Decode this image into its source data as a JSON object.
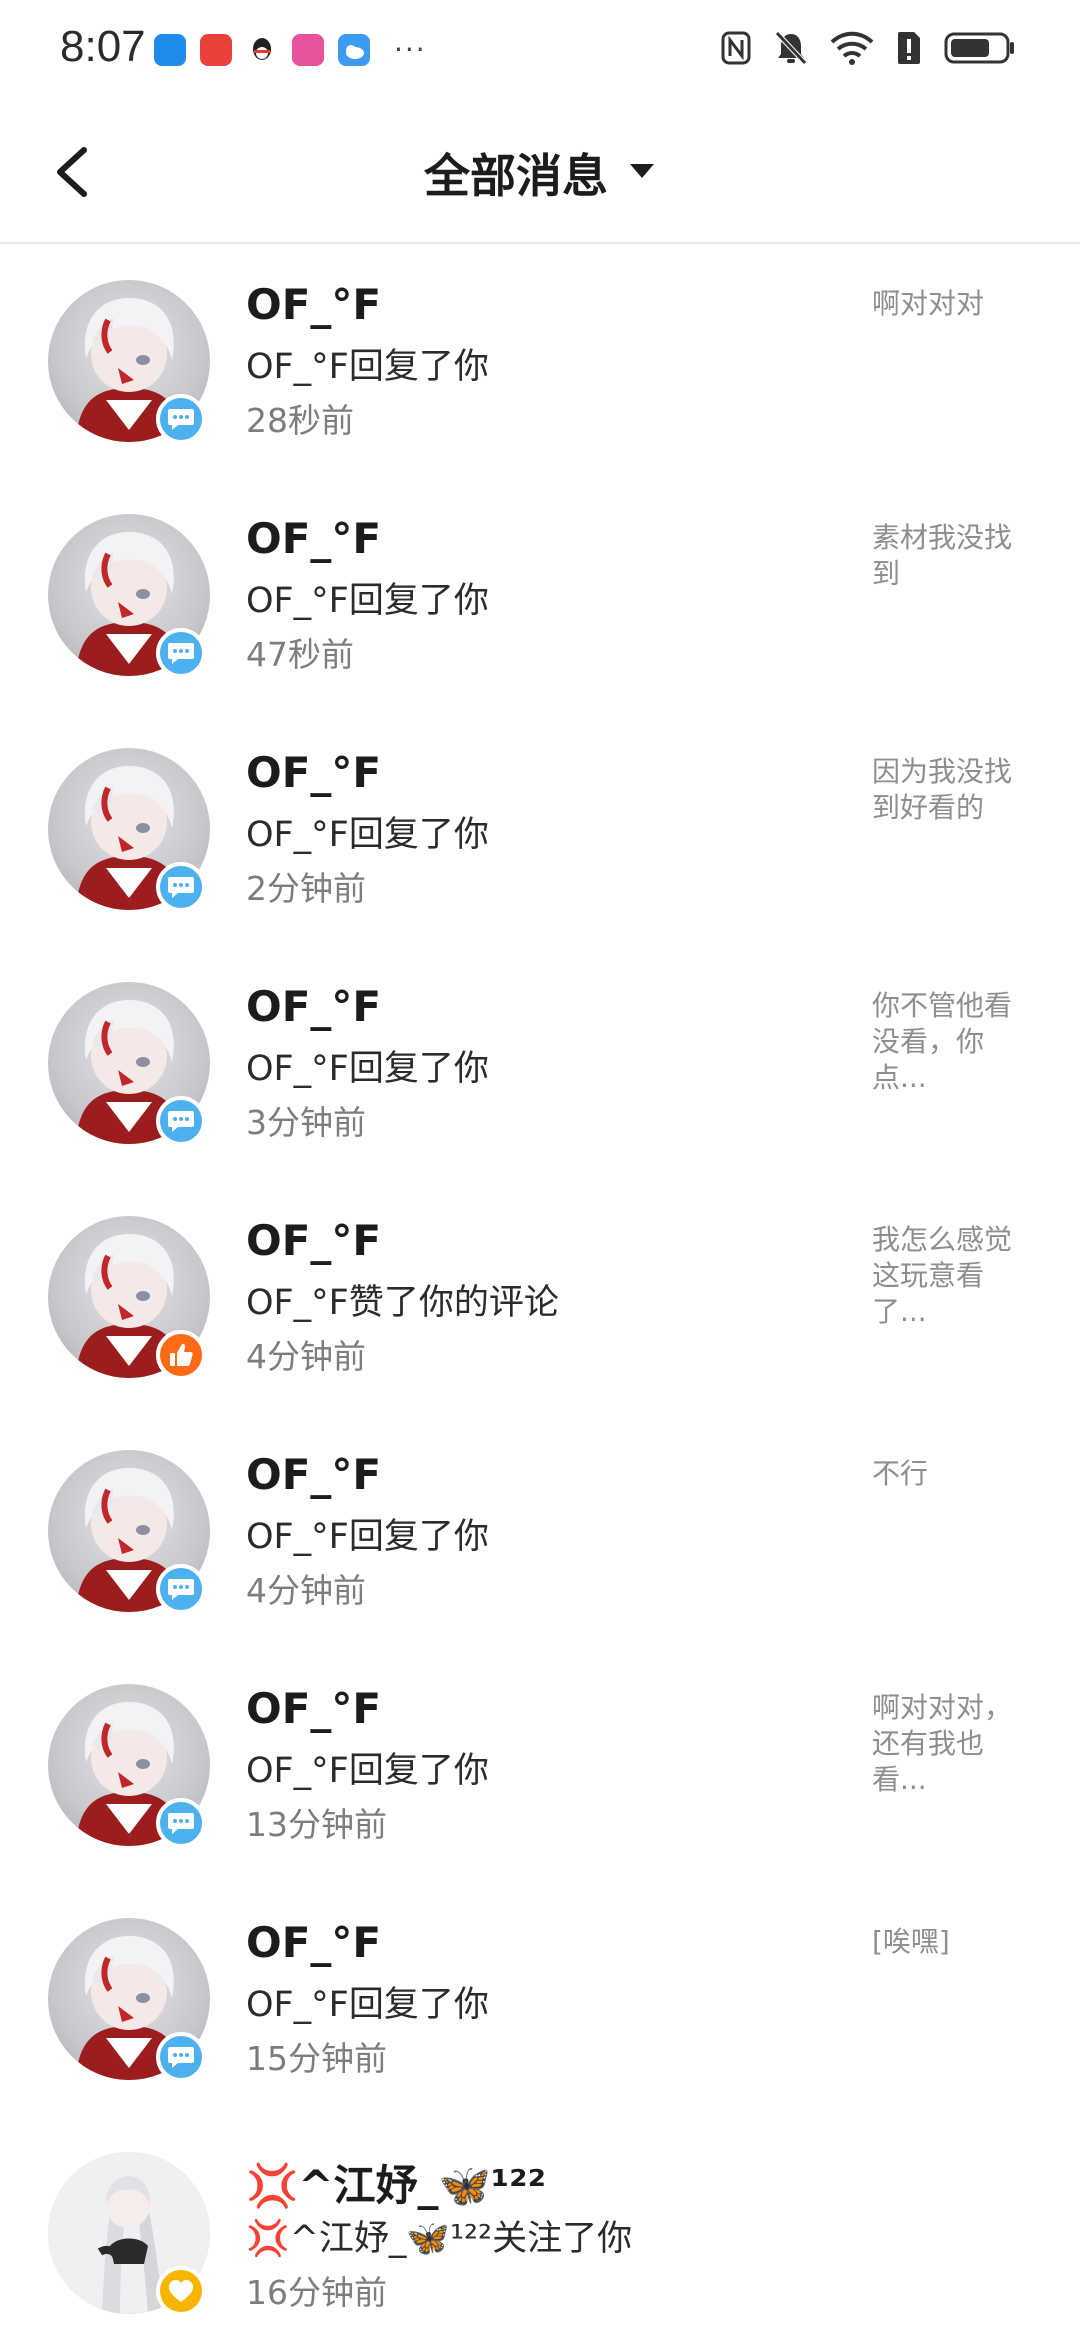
{
  "status_bar": {
    "time": "8:07",
    "app_icons": [
      {
        "icon": "app-blue-icon",
        "color": "#1e8ce8"
      },
      {
        "icon": "huawei-app-icon",
        "color": "#e8413c"
      },
      {
        "icon": "qq-penguin-icon",
        "color": "#222222"
      },
      {
        "icon": "pink-app-icon",
        "color": "#e8529a"
      },
      {
        "icon": "weather-icon",
        "color": "#3a9bf0"
      }
    ],
    "more_indicator": "···",
    "right_icons": [
      "nfc-icon",
      "bell-muted-icon",
      "wifi-icon",
      "sim-alert-icon",
      "battery-icon"
    ]
  },
  "header": {
    "title": "全部消息",
    "back_icon": "back-arrow-icon",
    "dropdown_icon": "caret-down-icon"
  },
  "colors": {
    "reply_badge": "#4db0ef",
    "like_badge": "#ff6a16",
    "follow_badge": "#f7b500",
    "preview_text": "#8e8e8e",
    "time_text": "#7d7d7d"
  },
  "messages": [
    {
      "name": "OF_°F",
      "action": "OF_°F回复了你",
      "time": "28秒前",
      "preview": "啊对对对",
      "badge": "reply"
    },
    {
      "name": "OF_°F",
      "action": "OF_°F回复了你",
      "time": "47秒前",
      "preview": "素材我没找到",
      "badge": "reply"
    },
    {
      "name": "OF_°F",
      "action": "OF_°F回复了你",
      "time": "2分钟前",
      "preview": "因为我没找到好看的",
      "badge": "reply"
    },
    {
      "name": "OF_°F",
      "action": "OF_°F回复了你",
      "time": "3分钟前",
      "preview": "你不管他看没看，你点...",
      "badge": "reply"
    },
    {
      "name": "OF_°F",
      "action": "OF_°F赞了你的评论",
      "time": "4分钟前",
      "preview": "我怎么感觉这玩意看了...",
      "badge": "like"
    },
    {
      "name": "OF_°F",
      "action": "OF_°F回复了你",
      "time": "4分钟前",
      "preview": "不行",
      "badge": "reply"
    },
    {
      "name": "OF_°F",
      "action": "OF_°F回复了你",
      "time": "13分钟前",
      "preview": "啊对对对，还有我也看...",
      "badge": "reply"
    },
    {
      "name": "OF_°F",
      "action": "OF_°F回复了你",
      "time": "15分钟前",
      "preview": "[唉嘿]",
      "badge": "reply"
    },
    {
      "name": "💢^江妤_🦋¹²²",
      "action": "💢^江妤_🦋¹²²关注了你",
      "time": "16分钟前",
      "preview": "",
      "badge": "follow"
    }
  ]
}
